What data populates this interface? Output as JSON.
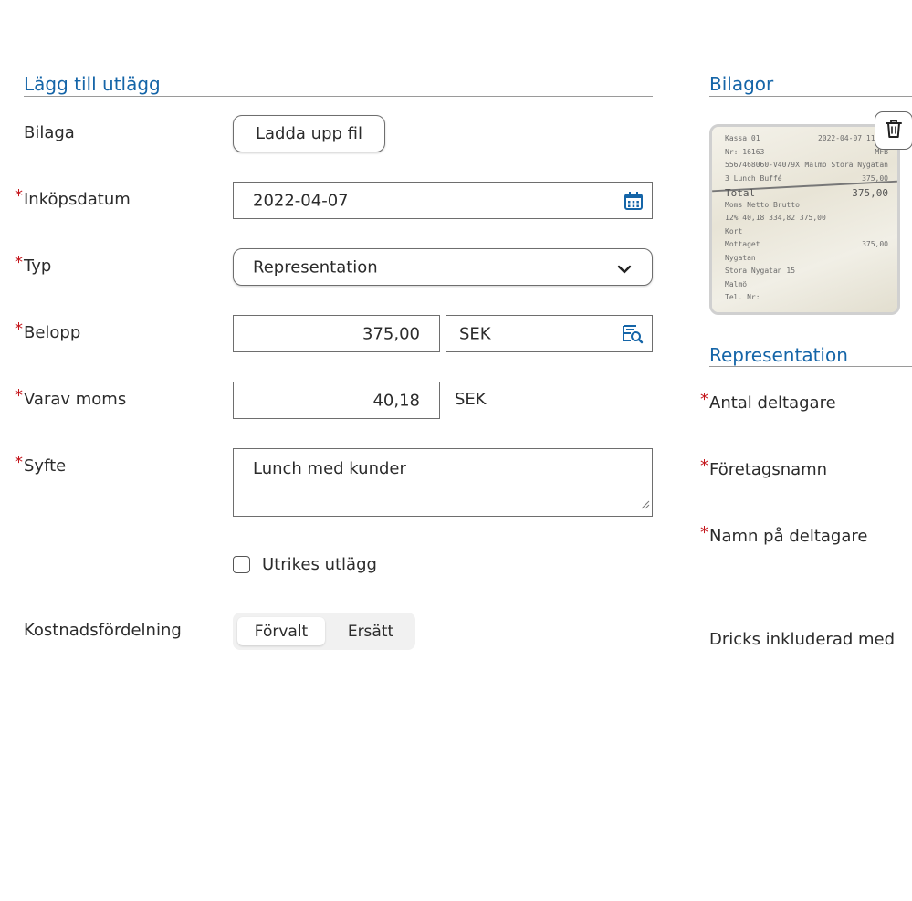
{
  "left_panel": {
    "title": "Lägg till utlägg",
    "attachment": {
      "label": "Bilaga",
      "upload_label": "Ladda upp fil"
    },
    "purchase_date": {
      "label": "Inköpsdatum",
      "value": "2022-04-07",
      "icon": "calendar-icon"
    },
    "type": {
      "label": "Typ",
      "value": "Representation",
      "icon": "chevron-down-icon"
    },
    "amount": {
      "label": "Belopp",
      "value": "375,00",
      "currency": "SEK",
      "icon": "currency-search-icon"
    },
    "vat": {
      "label": "Varav moms",
      "value": "40,18",
      "currency": "SEK"
    },
    "purpose": {
      "label": "Syfte",
      "value": "Lunch med kunder"
    },
    "foreign": {
      "label": "Utrikes utlägg",
      "checked": false
    },
    "cost_distribution": {
      "label": "Kostnadsfördelning",
      "options": [
        "Förvalt",
        "Ersätt"
      ],
      "selected": "Förvalt"
    }
  },
  "right_panel": {
    "attachments_title": "Bilagor",
    "delete_icon": "trash-icon",
    "receipt": {
      "lines": [
        [
          "Kassa 01",
          "2022-04-07 11:32"
        ],
        [
          "Nr: 16163",
          "MFB"
        ],
        [
          "5567468060-V4079X",
          "Malmö Stora Nygatan"
        ],
        [
          "3  Lunch Buffé",
          "375,00"
        ],
        [
          "Total",
          "375,00"
        ],
        [
          "Moms  Netto  Brutto",
          ""
        ],
        [
          "12%  40,18  334,82  375,00",
          ""
        ],
        [
          "Kort",
          ""
        ],
        [
          "Mottaget",
          "375,00"
        ],
        [
          "Nygatan",
          ""
        ],
        [
          "Stora Nygatan 15",
          ""
        ],
        [
          "Malmö",
          ""
        ],
        [
          "Tel. Nr:",
          ""
        ]
      ]
    },
    "representation_title": "Representation",
    "participants_count_label": "Antal deltagare",
    "company_name_label": "Företagsnamn",
    "participant_names_label": "Namn på deltagare",
    "tip_label": "Dricks inkluderad med"
  },
  "colors": {
    "accent": "#1565a8",
    "required": "#c4161c",
    "border": "#6e6e6e"
  }
}
